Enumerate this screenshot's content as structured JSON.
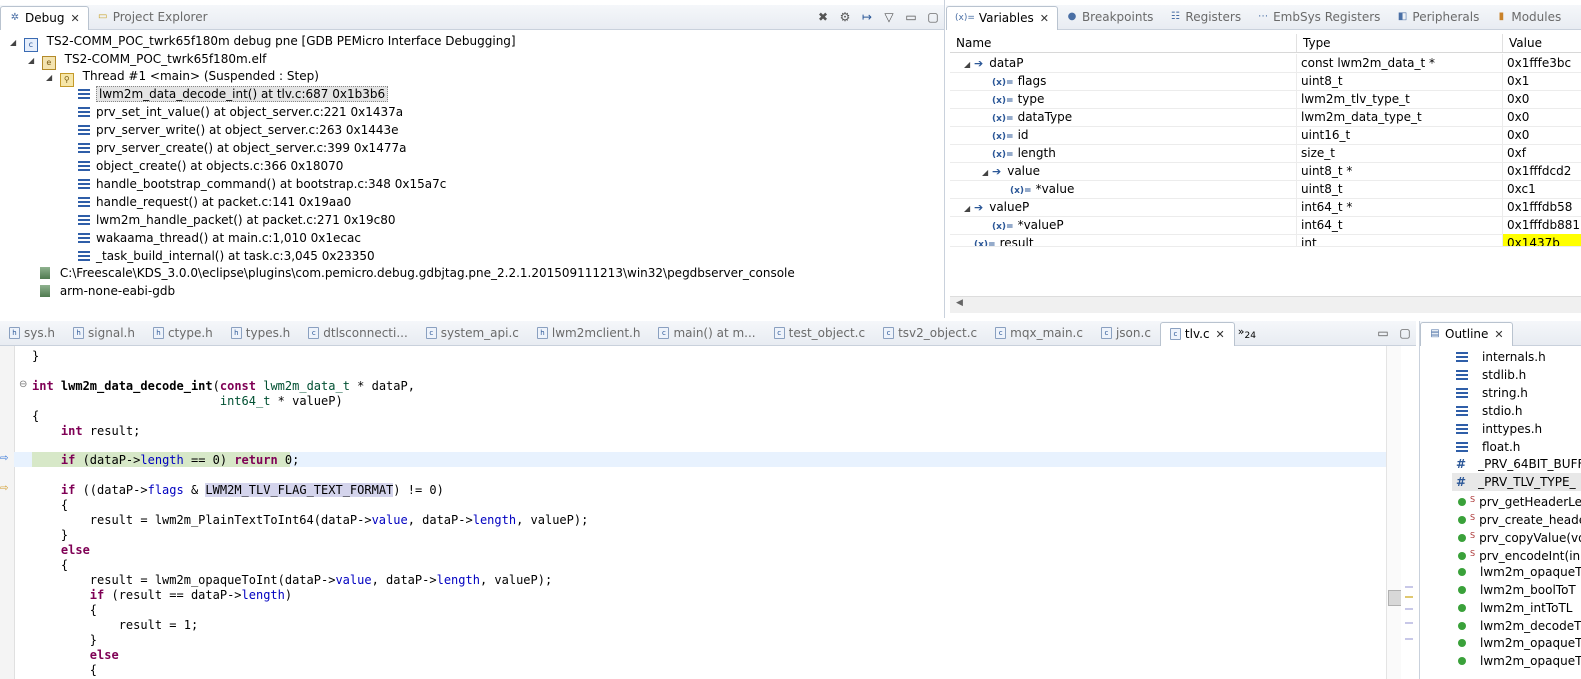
{
  "debug_panel": {
    "tabs": [
      {
        "label": "Debug",
        "active": true
      },
      {
        "label": "Project Explorer",
        "active": false
      }
    ],
    "tree": {
      "launch": "TS2-COMM_POC_twrk65f180m debug pne [GDB PEMicro Interface Debugging]",
      "elf": "TS2-COMM_POC_twrk65f180m.elf",
      "thread": "Thread #1 <main> (Suspended : Step)",
      "frames": [
        "lwm2m_data_decode_int() at tlv.c:687 0x1b3b6",
        "prv_set_int_value() at object_server.c:221 0x1437a",
        "prv_server_write() at object_server.c:263 0x1443e",
        "prv_server_create() at object_server.c:399 0x1477a",
        "object_create() at objects.c:366 0x18070",
        "handle_bootstrap_command() at bootstrap.c:348 0x15a7c",
        "handle_request() at packet.c:141 0x19aa0",
        "lwm2m_handle_packet() at packet.c:271 0x19c80",
        "wakaama_thread() at main.c:1,010 0x1ecac",
        "_task_build_internal() at task.c:3,045 0x23350"
      ],
      "server_process": "C:\\Freescale\\KDS_3.0.0\\eclipse\\plugins\\com.pemicro.debug.gdbjtag.pne_2.2.1.201509111213\\win32\\pegdbserver_console",
      "gdb_process": "arm-none-eabi-gdb"
    }
  },
  "variables_panel": {
    "tabs": [
      "Variables",
      "Breakpoints",
      "Registers",
      "EmbSys Registers",
      "Peripherals",
      "Modules"
    ],
    "columns": [
      "Name",
      "Type",
      "Value"
    ],
    "rows": [
      {
        "name": "dataP",
        "type": "const lwm2m_data_t *",
        "value": "0x1fffe3bc",
        "level": 0,
        "kind": "ptr",
        "expanded": true
      },
      {
        "name": "flags",
        "type": "uint8_t",
        "value": "0x1",
        "level": 1,
        "kind": "var"
      },
      {
        "name": "type",
        "type": "lwm2m_tlv_type_t",
        "value": "0x0",
        "level": 1,
        "kind": "var"
      },
      {
        "name": "dataType",
        "type": "lwm2m_data_type_t",
        "value": "0x0",
        "level": 1,
        "kind": "var"
      },
      {
        "name": "id",
        "type": "uint16_t",
        "value": "0x0",
        "level": 1,
        "kind": "var"
      },
      {
        "name": "length",
        "type": "size_t",
        "value": "0xf",
        "level": 1,
        "kind": "var"
      },
      {
        "name": "value",
        "type": "uint8_t *",
        "value": "0x1fffdcd2",
        "level": 1,
        "kind": "ptr",
        "expanded": true
      },
      {
        "name": "*value",
        "type": "uint8_t",
        "value": "0xc1",
        "level": 2,
        "kind": "var"
      },
      {
        "name": "valueP",
        "type": "int64_t *",
        "value": "0x1fffdb58",
        "level": 0,
        "kind": "ptr",
        "expanded": true
      },
      {
        "name": "*valueP",
        "type": "int64_t",
        "value": "0x1fffdb881",
        "level": 1,
        "kind": "var"
      },
      {
        "name": "result",
        "type": "int",
        "value": "0x1437b",
        "level": 0,
        "kind": "var",
        "changed": true
      }
    ]
  },
  "editor": {
    "tabs": [
      "sys.h",
      "signal.h",
      "ctype.h",
      "types.h",
      "dtlsconnecti...",
      "system_api.c",
      "lwm2mclient.h",
      "main() at m...",
      "test_object.c",
      "tsv2_object.c",
      "mqx_main.c",
      "json.c",
      "tlv.c"
    ],
    "active_tab": "tlv.c",
    "overflow_count": "24",
    "code_lines": {
      "l0": "}",
      "l2a": "int",
      "l2b": " lwm2m_data_decode_int",
      "l2c": "(",
      "l2d": "const",
      "l2e": " ",
      "l2f": "lwm2m_data_t",
      "l2g": " * dataP,",
      "l3a": "                          ",
      "l3b": "int64_t",
      "l3c": " * valueP)",
      "l4": "{",
      "l5a": "    ",
      "l5b": "int",
      "l5c": " result;",
      "l7a": "    ",
      "l7b": "if",
      "l7c": " (dataP->",
      "l7d": "length",
      "l7e": " == 0) ",
      "l7f": "return",
      "l7g": " 0;",
      "l9a": "    ",
      "l9b": "if",
      "l9c": " ((dataP->",
      "l9d": "flags",
      "l9e": " & ",
      "l9f": "LWM2M_TLV_FLAG_TEXT_FORMAT",
      "l9g": ") != 0)",
      "l10": "    {",
      "l11a": "        result = lwm2m_PlainTextToInt64(dataP->",
      "l11b": "value",
      "l11c": ", dataP->",
      "l11d": "length",
      "l11e": ", valueP);",
      "l12": "    }",
      "l13a": "    ",
      "l13b": "else",
      "l14": "    {",
      "l15a": "        result = lwm2m_opaqueToInt(dataP->",
      "l15b": "value",
      "l15c": ", dataP->",
      "l15d": "length",
      "l15e": ", valueP);",
      "l16a": "        ",
      "l16b": "if",
      "l16c": " (result == dataP->",
      "l16d": "length",
      "l16e": ")",
      "l17": "        {",
      "l18": "            result = 1;",
      "l19": "        }",
      "l20a": "        ",
      "l20b": "else",
      "l21": "        {"
    }
  },
  "outline_panel": {
    "tab": "Outline",
    "items": [
      {
        "label": "internals.h",
        "kind": "include"
      },
      {
        "label": "stdlib.h",
        "kind": "include"
      },
      {
        "label": "string.h",
        "kind": "include"
      },
      {
        "label": "stdio.h",
        "kind": "include"
      },
      {
        "label": "inttypes.h",
        "kind": "include"
      },
      {
        "label": "float.h",
        "kind": "include"
      },
      {
        "label": "_PRV_64BIT_BUFF",
        "kind": "macro"
      },
      {
        "label": "_PRV_TLV_TYPE_",
        "kind": "macro",
        "selected": true
      },
      {
        "label": "prv_getHeaderLe",
        "kind": "static"
      },
      {
        "label": "prv_create_heade",
        "kind": "static"
      },
      {
        "label": "prv_copyValue(vo",
        "kind": "static"
      },
      {
        "label": "prv_encodeInt(in",
        "kind": "static"
      },
      {
        "label": "lwm2m_opaqueT",
        "kind": "func"
      },
      {
        "label": "lwm2m_boolToT",
        "kind": "func"
      },
      {
        "label": "lwm2m_intToTL",
        "kind": "func"
      },
      {
        "label": "lwm2m_decodeT",
        "kind": "func"
      },
      {
        "label": "lwm2m_opaqueT",
        "kind": "func"
      },
      {
        "label": "lwm2m_opaqueT",
        "kind": "func"
      }
    ]
  },
  "colors": {
    "current_line": "#e8f2fe",
    "highlight_line": "#d7e8c8",
    "changed_value": "#ffff00",
    "keyword": "#7f0055",
    "field": "#0000c0"
  }
}
